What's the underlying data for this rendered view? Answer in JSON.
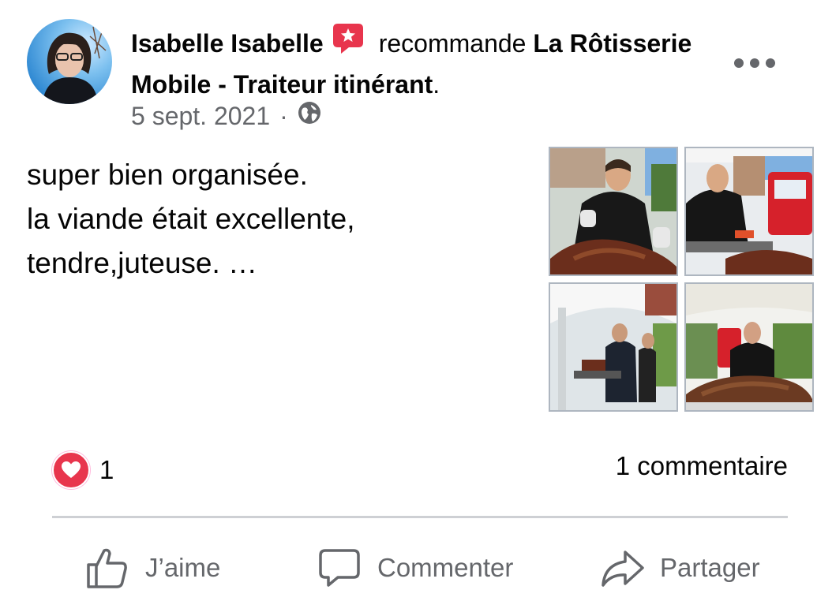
{
  "post": {
    "author": "Isabelle Isabelle",
    "action": "recommande",
    "page_name": "La Rôtisserie Mobile - Traiteur itinérant",
    "punctuation": ".",
    "date": "5 sept. 2021",
    "separator": "·",
    "privacy_icon": "globe-icon",
    "text_lines": [
      "super bien organisée.",
      "la viande était excellente,",
      "tendre,juteuse. …"
    ]
  },
  "stats": {
    "reaction_type": "love",
    "reaction_count": "1",
    "comments": "1 commentaire"
  },
  "actions": {
    "like": "J’aime",
    "comment": "Commenter",
    "share": "Partager"
  },
  "colors": {
    "secondary_text": "#65676b",
    "love_red": "#e8354d",
    "divider": "#ced0d4"
  }
}
